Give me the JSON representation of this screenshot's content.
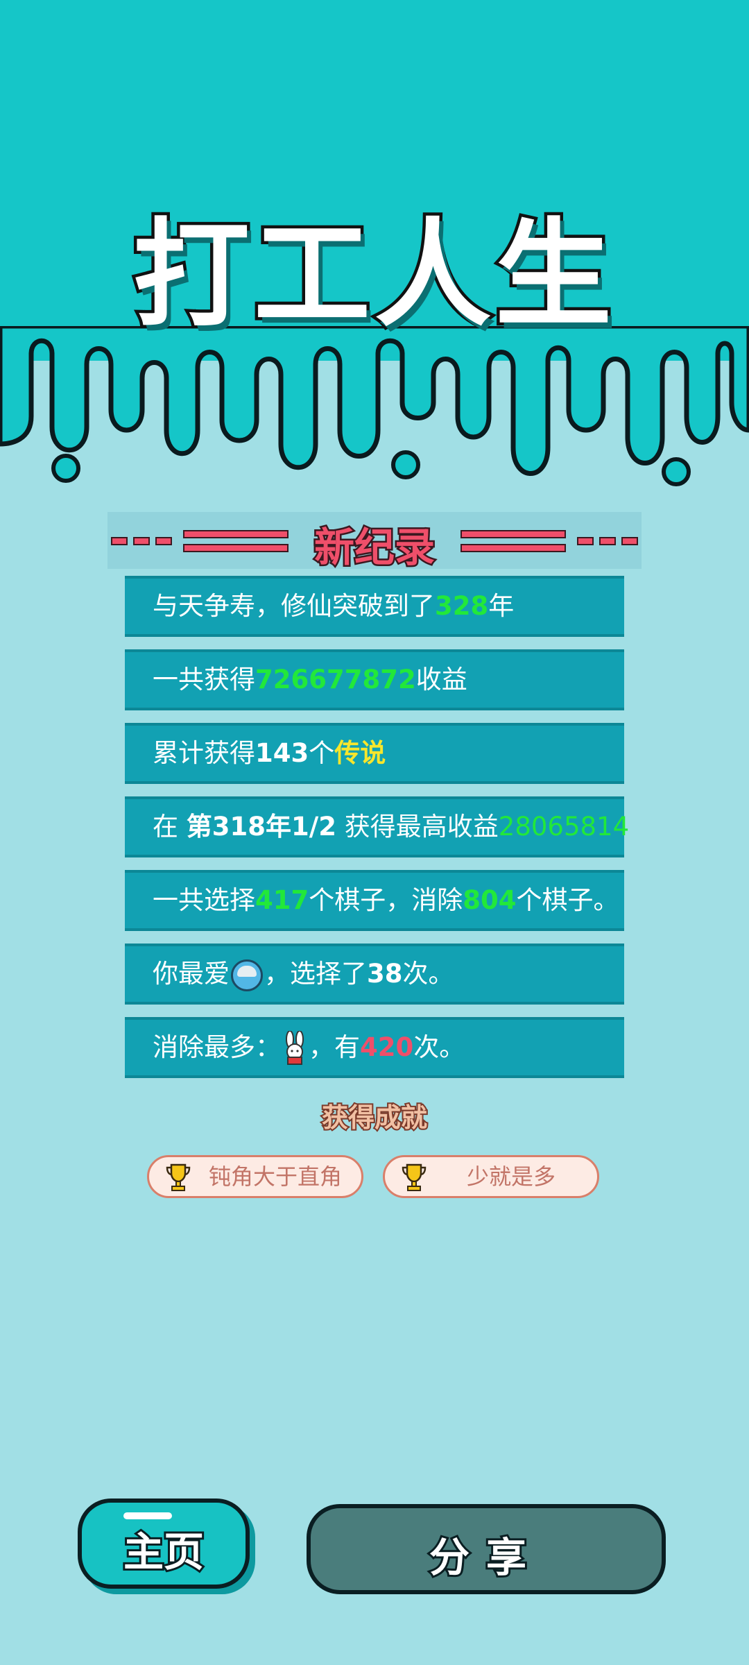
{
  "app": {
    "title": "打工人生",
    "record_title": "新纪录"
  },
  "stats": [
    {
      "parts": [
        "与天争寿，修仙突破到了",
        "328",
        "年"
      ]
    },
    {
      "parts": [
        "一共获得",
        "726677872",
        "收益"
      ]
    },
    {
      "parts": [
        "累计获得",
        "143",
        "个",
        "传说"
      ]
    },
    {
      "parts": [
        "在 ",
        "第318年1/2",
        " 获得最高收益",
        "28065814"
      ]
    },
    {
      "parts": [
        "一共选择",
        "417",
        "个棋子，消除",
        "804",
        "个棋子。"
      ]
    },
    {
      "parts": [
        "你最爱",
        "，选择了",
        "38",
        "次。"
      ],
      "icon": "food-bowl-icon"
    },
    {
      "parts": [
        "消除最多：",
        "，有",
        "420",
        "次。"
      ],
      "icon": "bunny-icon"
    }
  ],
  "achievements": {
    "title": "获得成就",
    "items": [
      {
        "label": "钝角大于直角",
        "icon": "trophy-icon"
      },
      {
        "label": "少就是多",
        "icon": "trophy-icon"
      }
    ]
  },
  "buttons": {
    "home": "主页",
    "share": "分享"
  },
  "colors": {
    "top_background": "#15c6c8",
    "page_background": "#a1dfe5",
    "row_background": "#12a1b3",
    "highlight_green": "#22e83a",
    "highlight_yellow": "#f7e62c",
    "highlight_red": "#ef4f6a"
  }
}
